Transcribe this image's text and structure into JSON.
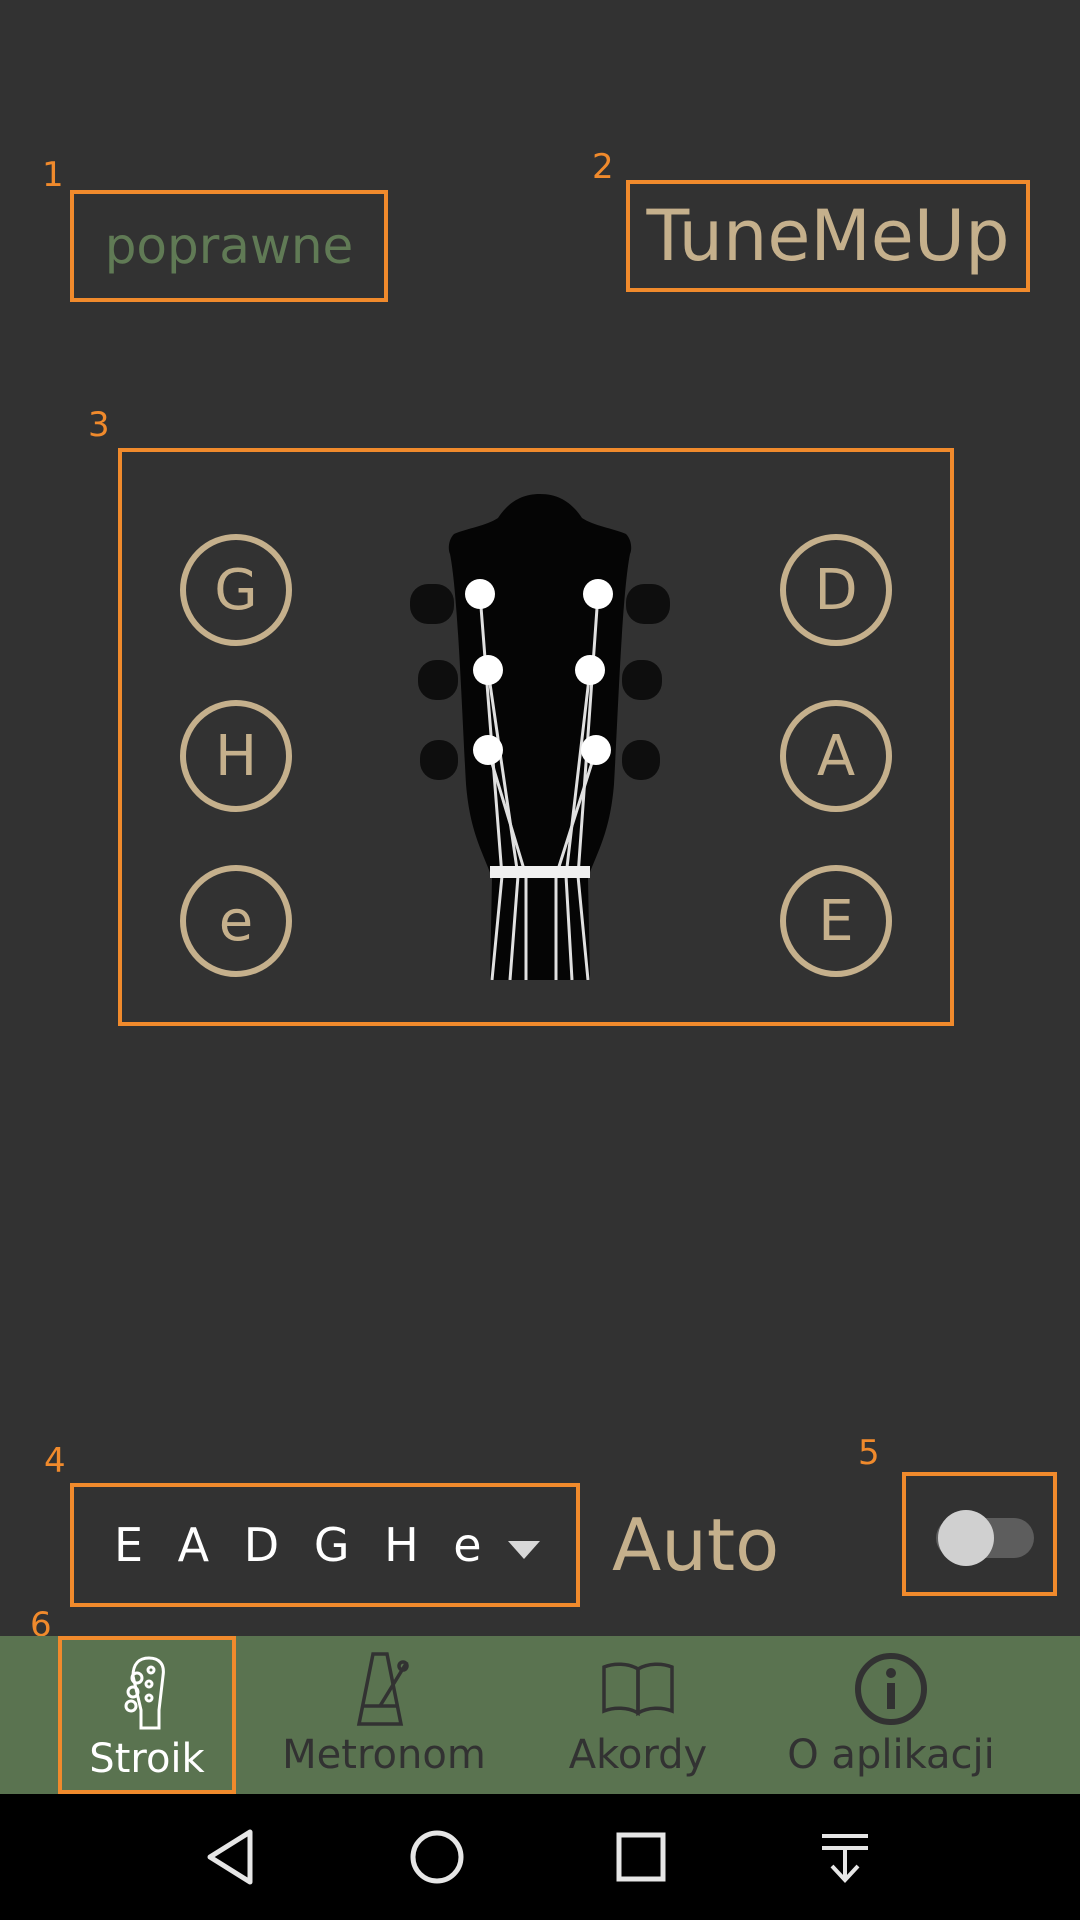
{
  "annotations": {
    "n1": "1",
    "n2": "2",
    "n3": "3",
    "n4": "4",
    "n5": "5",
    "n6": "6"
  },
  "header": {
    "status": "poprawne",
    "app_title": "TuneMeUp"
  },
  "tuner": {
    "left_pegs": [
      "G",
      "H",
      "e"
    ],
    "right_pegs": [
      "D",
      "A",
      "E"
    ],
    "headstock_icon": "guitar-headstock-icon"
  },
  "controls": {
    "tuning_value": "E A D G H e",
    "auto_label": "Auto",
    "auto_enabled": false
  },
  "bottom_nav": {
    "items": [
      {
        "label": "Stroik",
        "icon": "headstock-icon",
        "active": true
      },
      {
        "label": "Metronom",
        "icon": "metronome-icon",
        "active": false
      },
      {
        "label": "Akordy",
        "icon": "book-icon",
        "active": false
      },
      {
        "label": "O aplikacji",
        "icon": "info-icon",
        "active": false
      }
    ]
  },
  "system_nav": [
    "back-icon",
    "home-icon",
    "recents-icon",
    "notifications-pull-icon"
  ],
  "colors": {
    "background": "#323232",
    "accent_tan": "#c5b08c",
    "status_green": "#607a55",
    "nav_green": "#5a7350",
    "annotation_orange": "#f08a2c"
  }
}
